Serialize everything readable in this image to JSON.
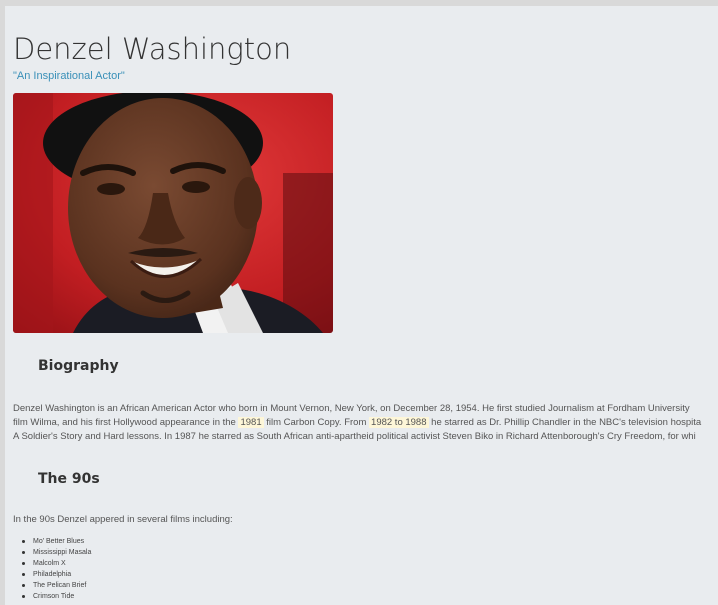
{
  "header": {
    "name": "Denzel Washington",
    "tagline": "\"An Inspirational Actor\""
  },
  "portrait": {
    "alt": "Denzel Washington"
  },
  "biography": {
    "heading": "Biography",
    "line1": "Denzel Washington is an African American Actor who born in Mount Vernon, New York, on December 28, 1954. He first studied Journalism at Fordham University",
    "line2_a": "film Wilma, and his first Hollywood appearance in the",
    "line2_year": "1981",
    "line2_b": "film Carbon Copy. From",
    "line2_range": "1982 to 1988",
    "line2_c": "he starred as Dr. Phillip Chandler in the NBC's television hospita",
    "line3": "A Soldier's Story and Hard lessons. In 1987 he starred as South African anti-apartheid political activist Steven Biko in Richard Attenborough's Cry Freedom, for whi"
  },
  "nineties": {
    "heading": "The 90s",
    "intro": "In the 90s Denzel appered in several films including:",
    "films": [
      "Mo' Better Blues",
      "Mississippi Masala",
      "Malcolm X",
      "Philadelphia",
      "The Pelican Brief",
      "Crimson Tide"
    ]
  },
  "colors": {
    "page_background": "#e9ecef",
    "tagline": "#3a90b8",
    "highlight": "#fdf6d8"
  }
}
